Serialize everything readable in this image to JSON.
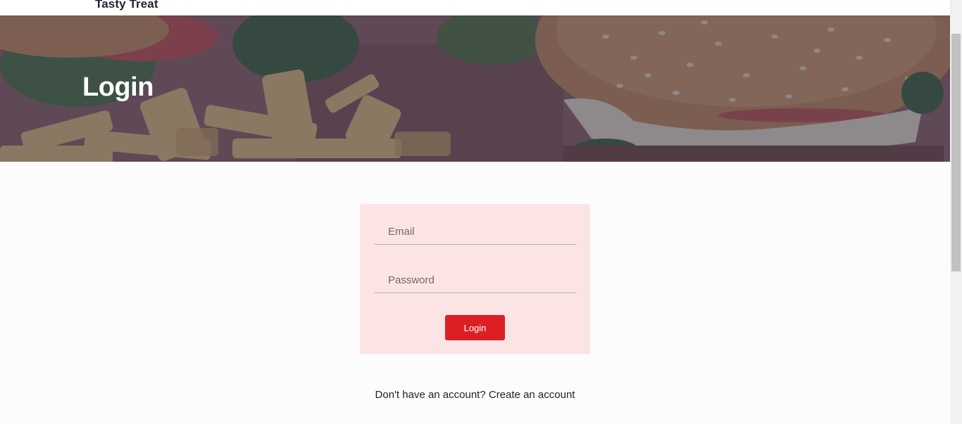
{
  "navbar": {
    "brand": "Tasty Treat"
  },
  "hero": {
    "title": "Login"
  },
  "login_form": {
    "email_placeholder": "Email",
    "email_value": "",
    "password_placeholder": "Password",
    "password_value": "",
    "submit_label": "Login"
  },
  "signup": {
    "prompt": "Don't have an account?",
    "link_label": "Create an account"
  },
  "colors": {
    "accent": "#dc1f24",
    "card_background": "#fce4e4",
    "page_background": "#fcfcfc",
    "hero_overlay": "#3c3c5a"
  }
}
